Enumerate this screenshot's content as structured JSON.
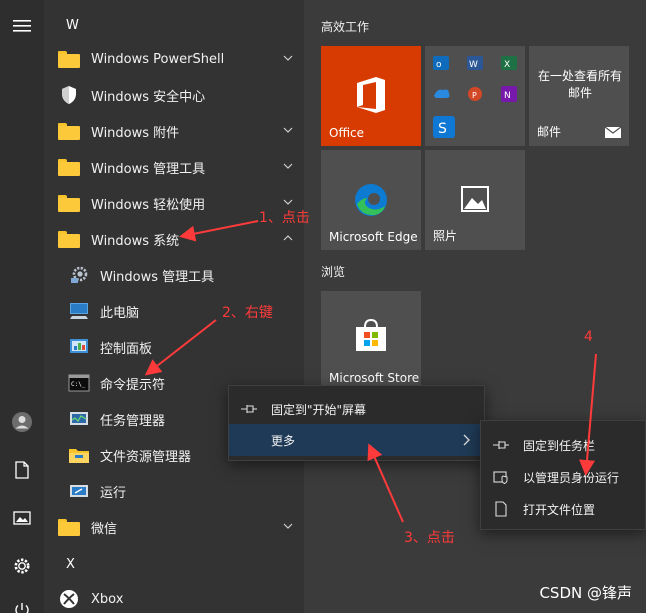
{
  "applist": {
    "section_w": "W",
    "section_x": "X",
    "items": [
      {
        "label": "Windows PowerShell"
      },
      {
        "label": "Windows 安全中心"
      },
      {
        "label": "Windows 附件"
      },
      {
        "label": "Windows 管理工具"
      },
      {
        "label": "Windows 轻松使用"
      },
      {
        "label": "Windows 系统"
      }
    ],
    "subitems": [
      {
        "label": "Windows 管理工具"
      },
      {
        "label": "此电脑"
      },
      {
        "label": "控制面板"
      },
      {
        "label": "命令提示符"
      },
      {
        "label": "任务管理器"
      },
      {
        "label": "文件资源管理器"
      },
      {
        "label": "运行"
      }
    ],
    "weixin": "微信",
    "xbox": "Xbox"
  },
  "tiles": {
    "group1": "高效工作",
    "group2": "浏览",
    "office": "Office",
    "mail_preview": "在一处查看所有邮件",
    "mail": "邮件",
    "edge": "Microsoft Edge",
    "photos": "照片",
    "store": "Microsoft Store"
  },
  "context_menu": {
    "pin_start": "固定到\"开始\"屏幕",
    "more": "更多"
  },
  "submenu": {
    "pin_taskbar": "固定到任务栏",
    "run_admin": "以管理员身份运行",
    "open_location": "打开文件位置"
  },
  "annotations": {
    "a1": "1、点击",
    "a2": "2、右键",
    "a3": "3、点击",
    "a4": "4"
  },
  "watermark": "CSDN @锋声",
  "colors": {
    "office": "#d83b01",
    "tile_gray": "#4f4f4f",
    "highlight": "#1f3a56",
    "annotation": "#ff3a3a"
  }
}
